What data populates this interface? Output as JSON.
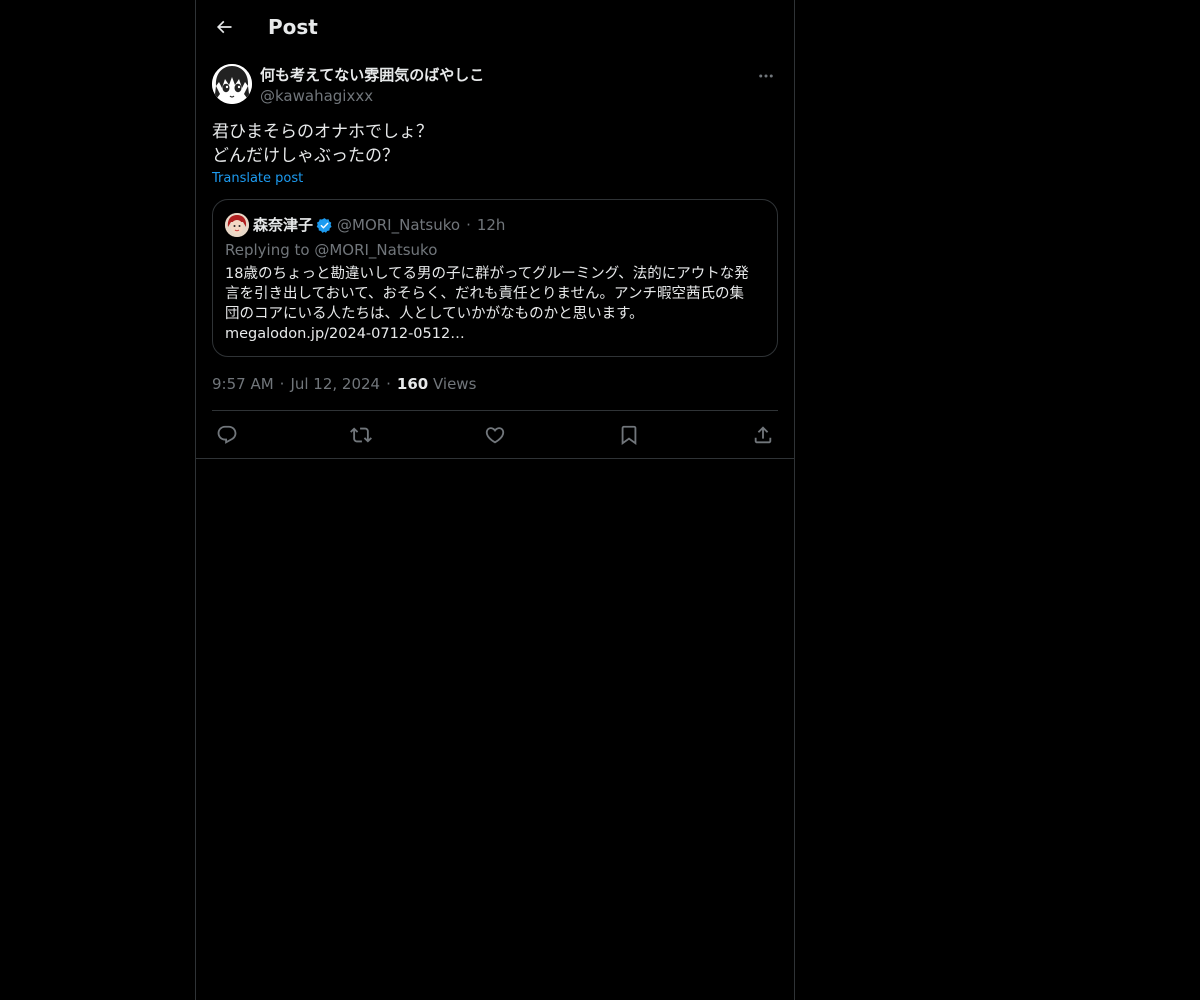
{
  "header": {
    "title": "Post"
  },
  "post": {
    "author_name": "何も考えてない雰囲気のばやしこ",
    "author_handle": "@kawahagixxx",
    "text_lines": [
      "君ひまそらのオナホでしょ？",
      "どんだけしゃぶったの？"
    ],
    "translate_label": "Translate post",
    "time": "9:57 AM",
    "date": "Jul 12, 2024",
    "views_count": "160",
    "views_label": "Views"
  },
  "quote": {
    "name": "森奈津子",
    "handle": "@MORI_Natsuko",
    "time": "12h",
    "replying_to": "Replying to @MORI_Natsuko",
    "body_lines": [
      "18歳のちょっと勘違いしてる男の子に群がってグルーミング、法的にアウトな発",
      "言を引き出しておいて、おそらく、だれも責任とりません。アンチ暇空茜氏の集",
      "団のコアにいる人たちは、人としていかがなものかと思います。",
      "megalodon.jp/2024-0712-0512…"
    ]
  },
  "icons": {
    "back": "arrow-left-icon",
    "more": "more-horizontal-icon",
    "verified": "verified-badge-icon",
    "reply": "reply-icon",
    "repost": "repost-icon",
    "like": "heart-icon",
    "bookmark": "bookmark-icon",
    "share": "share-icon"
  },
  "colors": {
    "background": "#000000",
    "text": "#e7e9ea",
    "muted": "#71767b",
    "accent": "#1d9bf0",
    "border": "#2f3336"
  }
}
